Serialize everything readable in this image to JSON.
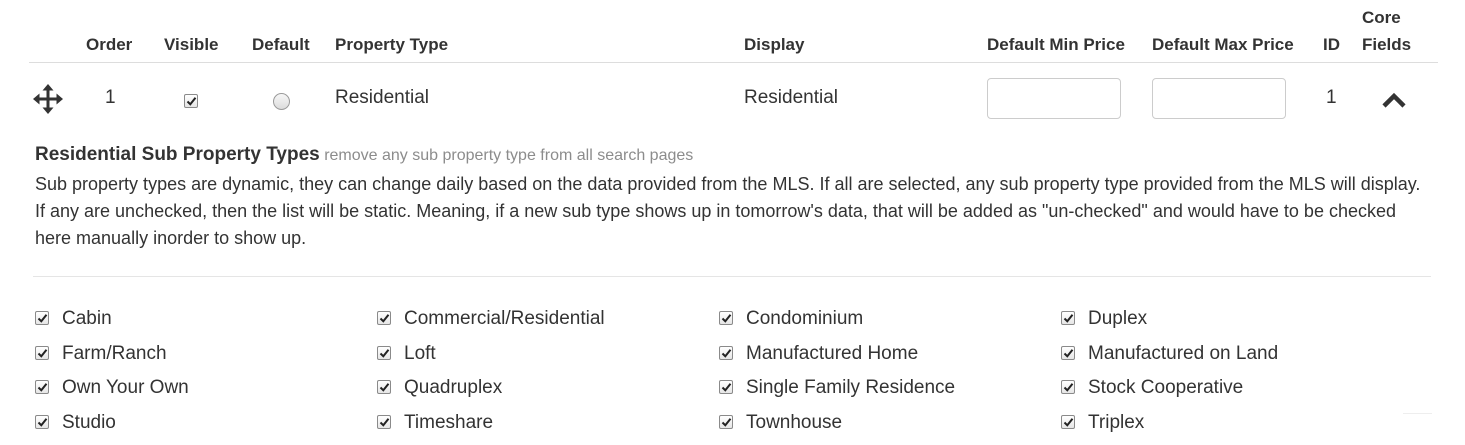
{
  "table": {
    "headers": {
      "order": "Order",
      "visible": "Visible",
      "default": "Default",
      "property_type": "Property Type",
      "display": "Display",
      "min_price": "Default Min Price",
      "max_price": "Default Max Price",
      "id": "ID",
      "core_fields_line1": "Core",
      "core_fields_line2": "Fields"
    },
    "row": {
      "order": "1",
      "visible": true,
      "default": false,
      "property_type": "Residential",
      "display": "Residential",
      "min_price": "",
      "max_price": "",
      "id": "1"
    }
  },
  "sub_types": {
    "title": "Residential Sub Property Types",
    "hint": "remove any sub property type from all search pages",
    "description": "Sub property types are dynamic, they can change daily based on the data provided from the MLS. If all are selected, any sub property type provided from the MLS will display. If any are unchecked, then the list will be static. Meaning, if a new sub type shows up in tomorrow's data, that will be added as \"un-checked\" and would have to be checked here manually inorder to show up.",
    "items": [
      {
        "label": "Cabin",
        "checked": true
      },
      {
        "label": "Commercial/Residential",
        "checked": true
      },
      {
        "label": "Condominium",
        "checked": true
      },
      {
        "label": "Duplex",
        "checked": true
      },
      {
        "label": "Farm/Ranch",
        "checked": true
      },
      {
        "label": "Loft",
        "checked": true
      },
      {
        "label": "Manufactured Home",
        "checked": true
      },
      {
        "label": "Manufactured on Land",
        "checked": true
      },
      {
        "label": "Own Your Own",
        "checked": true
      },
      {
        "label": "Quadruplex",
        "checked": true
      },
      {
        "label": "Single Family Residence",
        "checked": true
      },
      {
        "label": "Stock Cooperative",
        "checked": true
      },
      {
        "label": "Studio",
        "checked": true
      },
      {
        "label": "Timeshare",
        "checked": true
      },
      {
        "label": "Townhouse",
        "checked": true
      },
      {
        "label": "Triplex",
        "checked": true
      }
    ]
  },
  "icons": {
    "drag_handle": "move-arrows-icon",
    "collapse": "chevron-up-icon",
    "checkbox": "checkmark-icon"
  },
  "colors": {
    "text": "#333333",
    "hint": "#8c8c8c",
    "divider": "#dddddd"
  }
}
